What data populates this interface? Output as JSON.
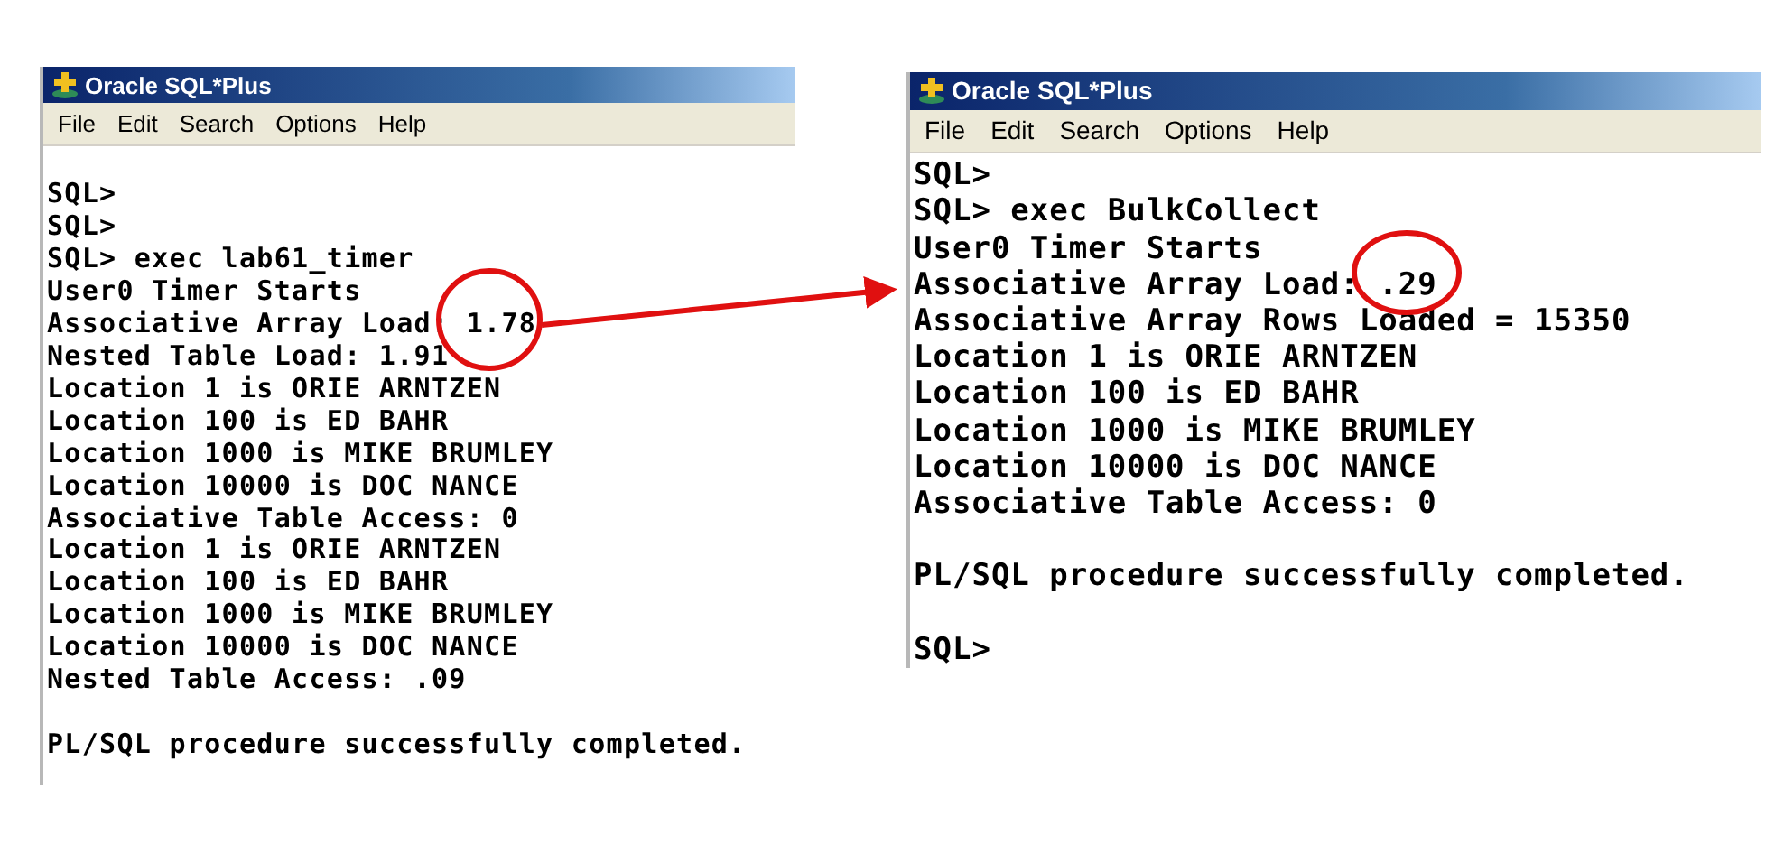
{
  "windows": [
    {
      "title": "Oracle SQL*Plus",
      "menu": [
        "File",
        "Edit",
        "Search",
        "Options",
        "Help"
      ],
      "blocks": [
        [
          "SQL>",
          "SQL>",
          "SQL> exec lab61_timer",
          "User0 Timer Starts",
          "Associative Array Load: 1.78",
          "Nested Table Load: 1.91",
          "Location 1 is ORIE ARNTZEN",
          "Location 100 is ED BAHR",
          "Location 1000 is MIKE BRUMLEY",
          "Location 10000 is DOC NANCE",
          "Associative Table Access: 0",
          "Location 1 is ORIE ARNTZEN",
          "Location 100 is ED BAHR",
          "Location 1000 is MIKE BRUMLEY",
          "Location 10000 is DOC NANCE",
          "Nested Table Access: .09"
        ],
        [
          "PL/SQL procedure successfully completed."
        ]
      ]
    },
    {
      "title": "Oracle SQL*Plus",
      "menu": [
        "File",
        "Edit",
        "Search",
        "Options",
        "Help"
      ],
      "blocks": [
        [
          "SQL>",
          "SQL> exec BulkCollect",
          "User0 Timer Starts",
          "Associative Array Load: .29",
          "Associative Array Rows Loaded = 15350",
          "Location 1 is ORIE ARNTZEN",
          "Location 100 is ED BAHR",
          "Location 1000 is MIKE BRUMLEY",
          "Location 10000 is DOC NANCE",
          "Associative Table Access: 0"
        ],
        [
          "PL/SQL procedure successfully completed."
        ],
        [
          "SQL>"
        ]
      ]
    }
  ]
}
